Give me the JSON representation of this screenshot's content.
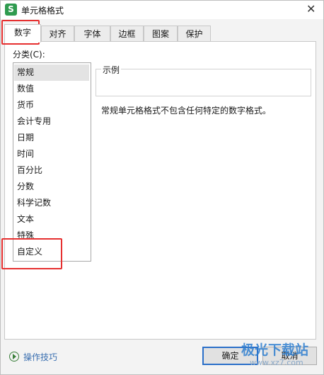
{
  "window": {
    "title": "单元格格式",
    "app_icon_letter": "S",
    "close_glyph": "✕"
  },
  "tabs": [
    {
      "label": "数字",
      "active": true
    },
    {
      "label": "对齐"
    },
    {
      "label": "字体"
    },
    {
      "label": "边框"
    },
    {
      "label": "图案"
    },
    {
      "label": "保护"
    }
  ],
  "category": {
    "label": "分类(C):",
    "items": [
      "常规",
      "数值",
      "货币",
      "会计专用",
      "日期",
      "时间",
      "百分比",
      "分数",
      "科学记数",
      "文本",
      "特殊",
      "自定义"
    ],
    "selected": "常规"
  },
  "sample": {
    "title": "示例",
    "value": ""
  },
  "description": "常规单元格格式不包含任何特定的数字格式。",
  "footer": {
    "tips_label": "操作技巧",
    "ok_label": "确定",
    "cancel_label": "取消"
  },
  "watermark": {
    "text": "极光下载站",
    "url": "www.xz7.com"
  },
  "colors": {
    "highlight": "#e63030",
    "accent": "#2a6fc9",
    "link": "#3a6fb0"
  }
}
